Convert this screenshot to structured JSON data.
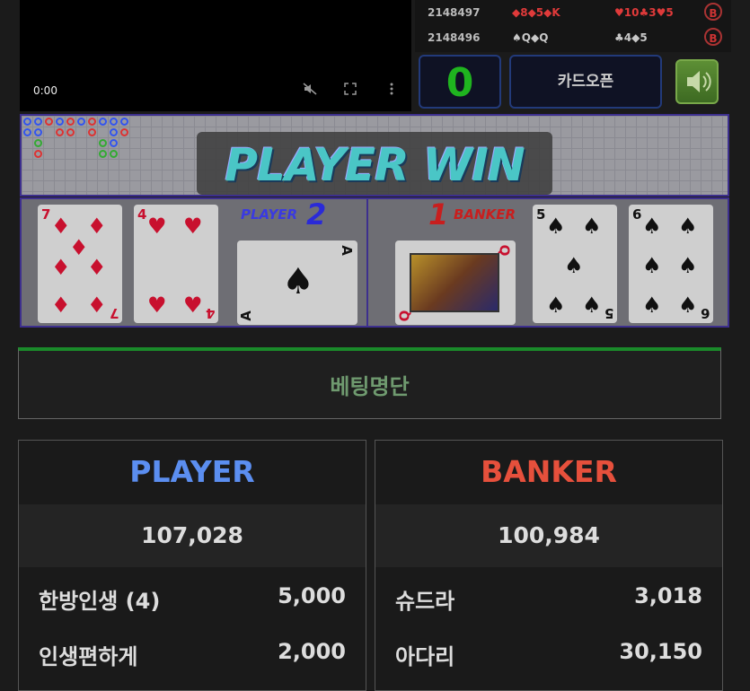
{
  "video": {
    "time": "0:00",
    "icons": [
      "mute-icon",
      "fullscreen-icon",
      "more-icon"
    ]
  },
  "history": [
    {
      "round": "2148497",
      "player_cards": "◆8◆5◆K",
      "banker_cards": "♥10♣3♥5",
      "winner": "B"
    },
    {
      "round": "2148496",
      "player_cards": "♠Q◆Q",
      "banker_cards": "♣4◆5",
      "winner": "B"
    }
  ],
  "controls": {
    "score": "0",
    "card_open_label": "카드오픈",
    "sound_icon": "speaker-icon"
  },
  "result_banner": "PLAYER WIN",
  "table": {
    "player_label": "PLAYER",
    "player_score": "2",
    "banker_label": "BANKER",
    "banker_score": "1",
    "player_cards": [
      {
        "rank": "7",
        "suit": "♦",
        "color": "#c8102e"
      },
      {
        "rank": "4",
        "suit": "♥",
        "color": "#c8102e"
      },
      {
        "rank": "A",
        "suit": "♠",
        "color": "#111111"
      }
    ],
    "banker_cards": [
      {
        "rank": "Q",
        "suit": "♥",
        "color": "#c8102e"
      },
      {
        "rank": "5",
        "suit": "♠",
        "color": "#111111"
      },
      {
        "rank": "6",
        "suit": "♠",
        "color": "#111111"
      }
    ]
  },
  "bet_list_title": "베팅명단",
  "player_panel": {
    "title": "PLAYER",
    "title_color": "#5b8ef0",
    "total": "107,028",
    "bets": [
      {
        "name": "한방인생 (4)",
        "amount": "5,000"
      },
      {
        "name": "인생편하게",
        "amount": "2,000"
      }
    ]
  },
  "banker_panel": {
    "title": "BANKER",
    "title_color": "#e6503c",
    "total": "100,984",
    "bets": [
      {
        "name": "슈드라",
        "amount": "3,018"
      },
      {
        "name": "아다리",
        "amount": "30,150"
      }
    ]
  },
  "colors": {
    "accent_green": "#1fb41f",
    "border_blue": "#3d2f8e",
    "bet_bar_green": "#1a8a2a"
  }
}
